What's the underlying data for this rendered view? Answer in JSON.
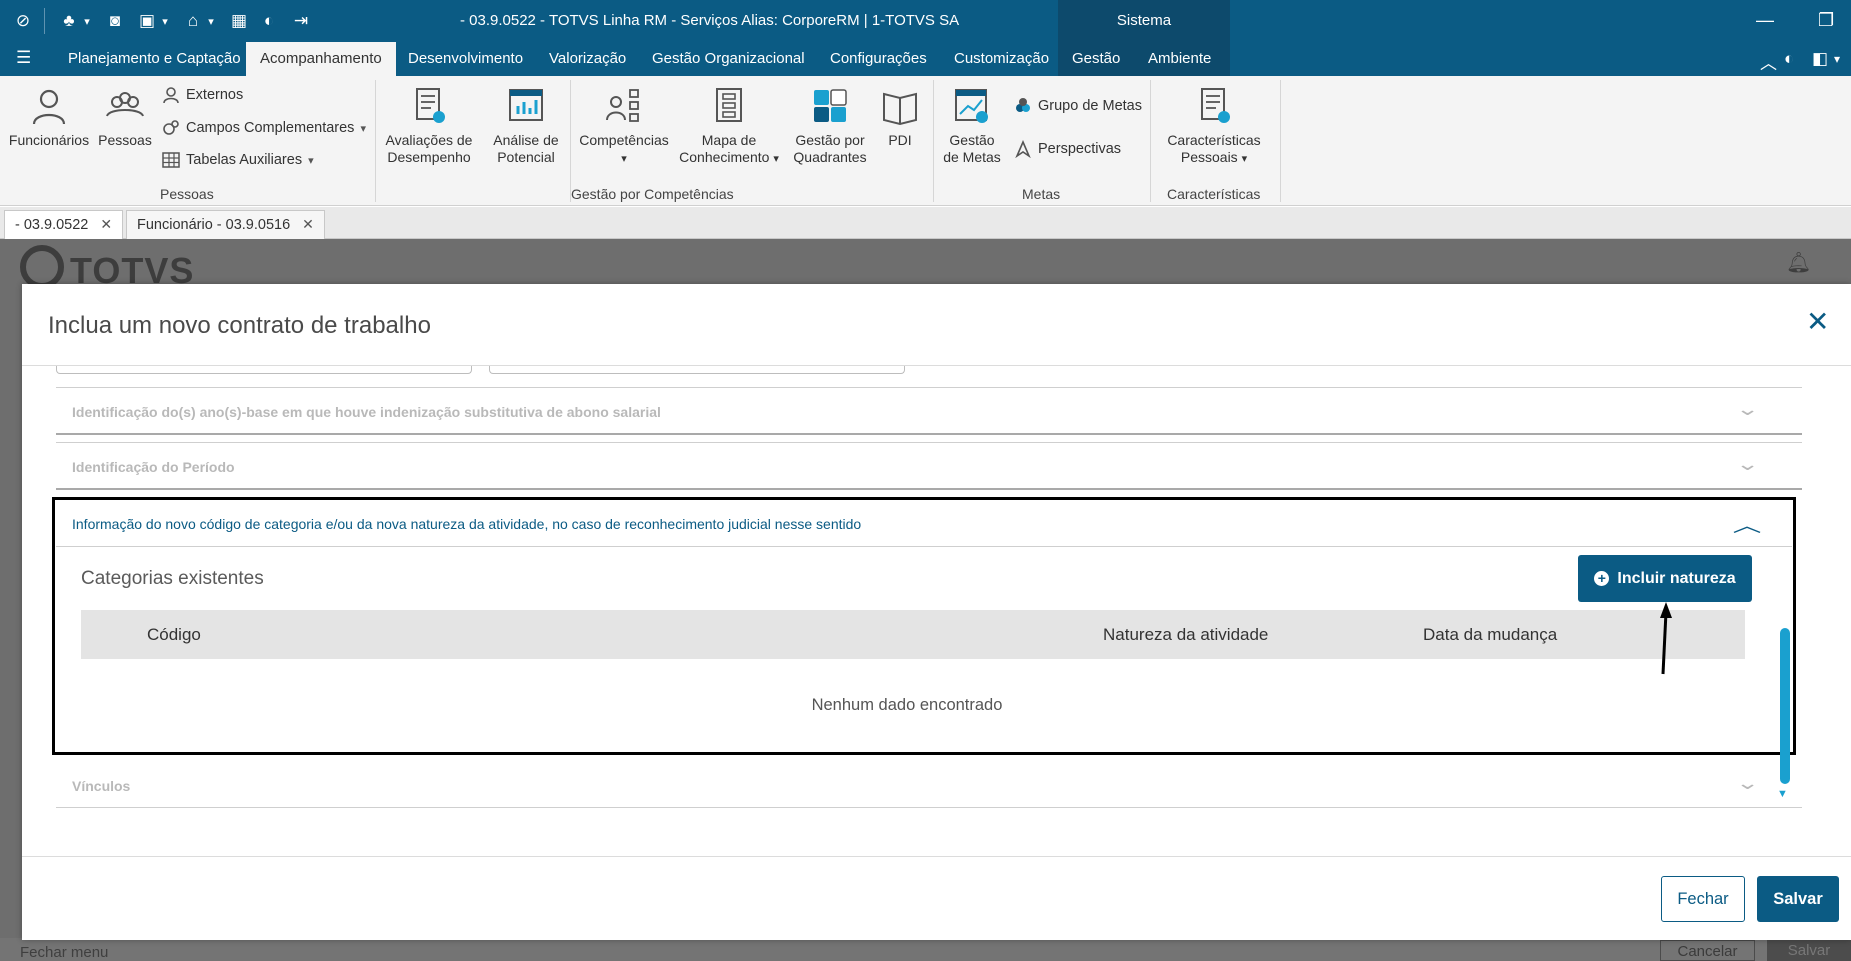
{
  "titlebar": {
    "title": "- 03.9.0522 - TOTVS Linha RM - Serviços  Alias: CorporeRM | 1-TOTVS SA",
    "sistema": "Sistema",
    "minimize": "—",
    "restore": "❐"
  },
  "menu": {
    "items": [
      "Planejamento e Captação",
      "Acompanhamento",
      "Desenvolvimento",
      "Valorização",
      "Gestão Organizacional",
      "Configurações",
      "Customização",
      "Gestão",
      "Ambiente"
    ],
    "active": "Acompanhamento"
  },
  "ribbon": {
    "funcionarios": "Funcionários",
    "pessoas": "Pessoas",
    "externos": "Externos",
    "campos_complementares": "Campos Complementares",
    "tabelas_auxiliares": "Tabelas Auxiliares",
    "group_pessoas": "Pessoas",
    "avaliacoes_1": "Avaliações de",
    "avaliacoes_2": "Desempenho",
    "analise_1": "Análise de",
    "analise_2": "Potencial",
    "competencias": "Competências",
    "mapa_1": "Mapa de",
    "mapa_2": "Conhecimento",
    "gestao_quad_1": "Gestão por",
    "gestao_quad_2": "Quadrantes",
    "pdi": "PDI",
    "group_gestao_comp": "Gestão por Competências",
    "gestao_metas_1": "Gestão",
    "gestao_metas_2": "de Metas",
    "grupo_metas": "Grupo de Metas",
    "perspectivas": "Perspectivas",
    "group_metas": "Metas",
    "caracteristicas_1": "Características",
    "caracteristicas_2": "Pessoais",
    "group_caracteristicas": "Características"
  },
  "tabs": [
    {
      "label": "- 03.9.0522"
    },
    {
      "label": "Funcionário - 03.9.0516"
    }
  ],
  "background": {
    "logo": "TOTVS",
    "footer_menu": "Fechar menu",
    "cancelar": "Cancelar",
    "salvar": "Salvar"
  },
  "modal": {
    "title": "Inclua um novo contrato de trabalho",
    "sections": [
      {
        "title": "Identificação do(s) ano(s)-base em que houve indenização substitutiva de abono salarial"
      },
      {
        "title": "Identificação do Período"
      },
      {
        "title": "Informação do novo código de categoria e/ou da nova natureza da atividade, no caso de reconhecimento judicial nesse sentido"
      },
      {
        "title": "Vínculos"
      }
    ],
    "categorias_title": "Categorias existentes",
    "incluir_button": "Incluir natureza",
    "table": {
      "columns": [
        "Código",
        "Natureza da atividade",
        "Data da mudança"
      ],
      "empty_message": "Nenhum dado encontrado"
    },
    "fechar_button": "Fechar",
    "salvar_button": "Salvar"
  },
  "colors": {
    "primary": "#0b5b84",
    "dark_primary": "#0d4a6c",
    "scrollbar": "#1aa0cf"
  }
}
